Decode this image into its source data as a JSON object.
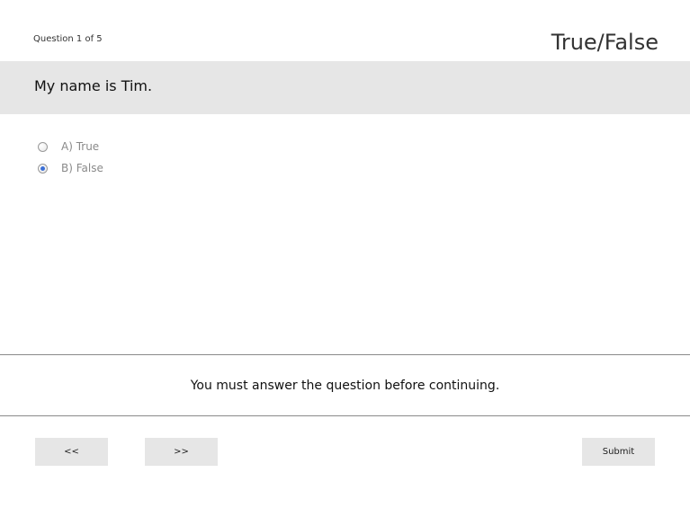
{
  "header": {
    "question_counter": "Question 1 of 5",
    "question_type": "True/False"
  },
  "question": {
    "text": "My name is Tim."
  },
  "options": [
    {
      "label": "A) True",
      "selected": false
    },
    {
      "label": "B) False",
      "selected": true
    }
  ],
  "message": {
    "text": "You must answer the question before continuing."
  },
  "nav": {
    "prev_label": "<<",
    "next_label": ">>",
    "submit_label": "Submit"
  },
  "colors": {
    "band_background": "#e6e6e6",
    "radio_selected": "#3b6fd6",
    "option_text": "#8a8a8a"
  }
}
